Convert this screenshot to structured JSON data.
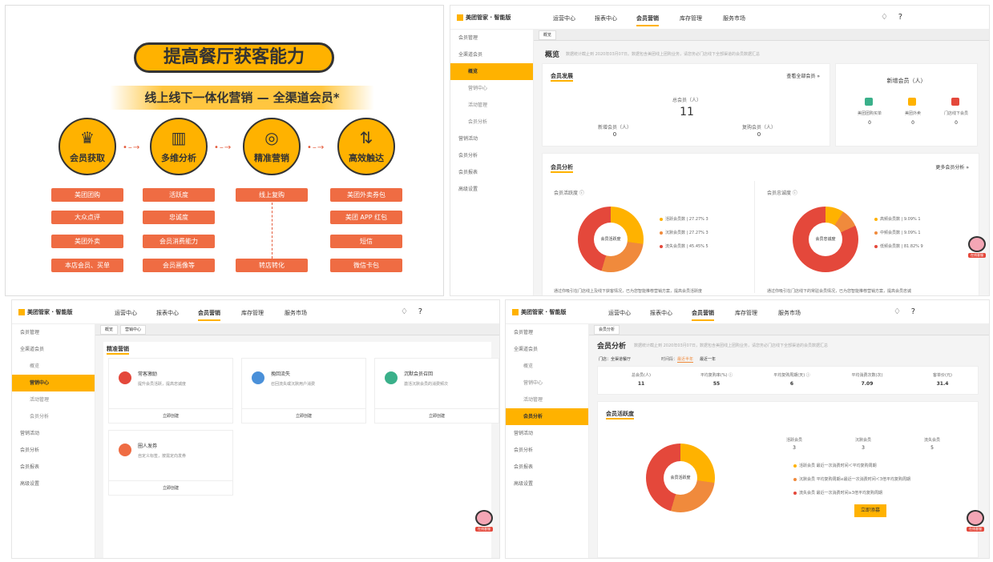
{
  "poster": {
    "title": "提高餐厅获客能力",
    "subtitle": "线上线下一体化营销 — 全渠道会员*",
    "columns": [
      {
        "label": "会员获取",
        "icon": "crown-icon",
        "glyph": "♛",
        "items": [
          "美团团购",
          "大众点评",
          "美团外卖",
          "本店会员、买单"
        ]
      },
      {
        "label": "多维分析",
        "icon": "chart-icon",
        "glyph": "▥",
        "items": [
          "活跃度",
          "忠诚度",
          "会员消费能力",
          "会员画像等"
        ]
      },
      {
        "label": "精准营销",
        "icon": "target-icon",
        "glyph": "◎",
        "items": [
          "线上复购",
          "转店转化"
        ]
      },
      {
        "label": "高效触达",
        "icon": "reach-icon",
        "glyph": "⇅",
        "items": [
          "美团外卖券包",
          "美团 APP 红包",
          "短信",
          "微信卡包"
        ]
      }
    ]
  },
  "app": {
    "logo": "美团管家 · 智能版",
    "nav": [
      "运营中心",
      "报表中心",
      "会员营销",
      "库存管理",
      "服务市场"
    ],
    "active_nav": "会员营销",
    "sidebar": [
      "会员管理",
      "全渠道会员",
      "概览",
      "营销中心",
      "活动管理",
      "会员分析",
      "营销活动",
      "会员分析",
      "会员报表",
      "高级设置"
    ]
  },
  "panel_overview": {
    "tab": "概览",
    "title": "概览",
    "desc": "数据统计截止到 2020年03月07日。数据包含美团线上团购业务，请您务必门店线下全部渠道的会员数据汇总",
    "dev_title": "会员发展",
    "dev_link": "查看全部会员 »",
    "total_label": "总会员（人）",
    "total": "11",
    "new_label": "新增会员（人）",
    "new_val": "0",
    "repurchase_label": "复购会员（人）",
    "repurchase_val": "0",
    "new_card_title": "新增会员（人）",
    "sources": [
      {
        "label": "美团团购买单",
        "val": "0"
      },
      {
        "label": "美团外卖",
        "val": "0"
      },
      {
        "label": "门店线下会员",
        "val": "0"
      }
    ],
    "analysis_title": "会员分析",
    "analysis_link": "更多会员分析 »",
    "activity_title": "会员活跃度 ⓘ",
    "activity_center": "会员活跃度",
    "activity_legend": [
      {
        "label": "活跃会员数 | 27.27%  3",
        "color": "#ffb200"
      },
      {
        "label": "沉默会员数 | 27.27%  3",
        "color": "#f08a3c"
      },
      {
        "label": "流失会员数 | 45.45%  5",
        "color": "#e4483b"
      }
    ],
    "loyalty_title": "会员忠诚度 ⓘ",
    "loyalty_center": "会员忠诚度",
    "loyalty_legend": [
      {
        "label": "高频会员数 | 9.09%  1",
        "color": "#ffb200"
      },
      {
        "label": "中频会员数 | 9.09%  1",
        "color": "#f08a3c"
      },
      {
        "label": "低频会员数 | 81.82%  9",
        "color": "#e4483b"
      }
    ],
    "foot1": "通过你吸引在门店线上及线下获客情况，已为您智能推荐营销方案，提高会员活跃度",
    "foot2": "通过你吸引在门店线下的常驻会员情况，已为您智能推荐营销方案，提高会员忠诚",
    "mascot": "在线客服"
  },
  "panel_marketing": {
    "tabs": [
      "概览",
      "营销中心"
    ],
    "title": "精准营销",
    "tiles": [
      {
        "title": "常客激励",
        "desc": "提升会员活跃，提高忠诚度",
        "btn": "立即创建",
        "color": "#e4483b"
      },
      {
        "title": "挽回流失",
        "desc": "召回流失或沉默用户消费",
        "btn": "立即创建",
        "color": "#4a90d9"
      },
      {
        "title": "沉默会员召回",
        "desc": "激活沉默会员的消费频次",
        "btn": "立即创建",
        "color": "#3ab08a"
      },
      {
        "title": "圈人发券",
        "desc": "自定义标签，按需定向发券",
        "btn": "立即创建",
        "color": "#ef6c43"
      }
    ],
    "mascot": "在线客服"
  },
  "panel_analysis": {
    "tab": "会员分析",
    "title": "会员分析",
    "desc": "数据统计截止到 2020年03月07日，数据包含美团线上团购业务，请您务必门店线下全部渠道的会员数据汇总",
    "store_label": "门店：全渠道餐厅",
    "time_label": "时间段：",
    "range1": "最近半年",
    "range2": "最近一年",
    "stats": [
      {
        "label": "总会员(人)",
        "val": "11"
      },
      {
        "label": "平均复购率(%) ⓘ",
        "val": "55"
      },
      {
        "label": "平均复购周期(天) ⓘ",
        "val": "6"
      },
      {
        "label": "平均消费次数(次)",
        "val": "7.09"
      },
      {
        "label": "客单价(元)",
        "val": "31.4"
      }
    ],
    "activity_title": "会员活跃度",
    "center": "会员活跃度",
    "counts": [
      {
        "label": "活跃会员",
        "val": "3"
      },
      {
        "label": "沉默会员",
        "val": "3"
      },
      {
        "label": "流失会员",
        "val": "5"
      }
    ],
    "legend": [
      {
        "label": "活跃会员  最近一次消费时间＜平均复购周期",
        "color": "#ffb200"
      },
      {
        "label": "沉默会员  平均复购周期≤最近一次消费时间＜3倍平均复购周期",
        "color": "#f08a3c"
      },
      {
        "label": "流失会员  最近一次消费时间≥3倍平均复购周期",
        "color": "#e4483b"
      }
    ],
    "cta": "立即添募",
    "mascot": "在线客服"
  }
}
